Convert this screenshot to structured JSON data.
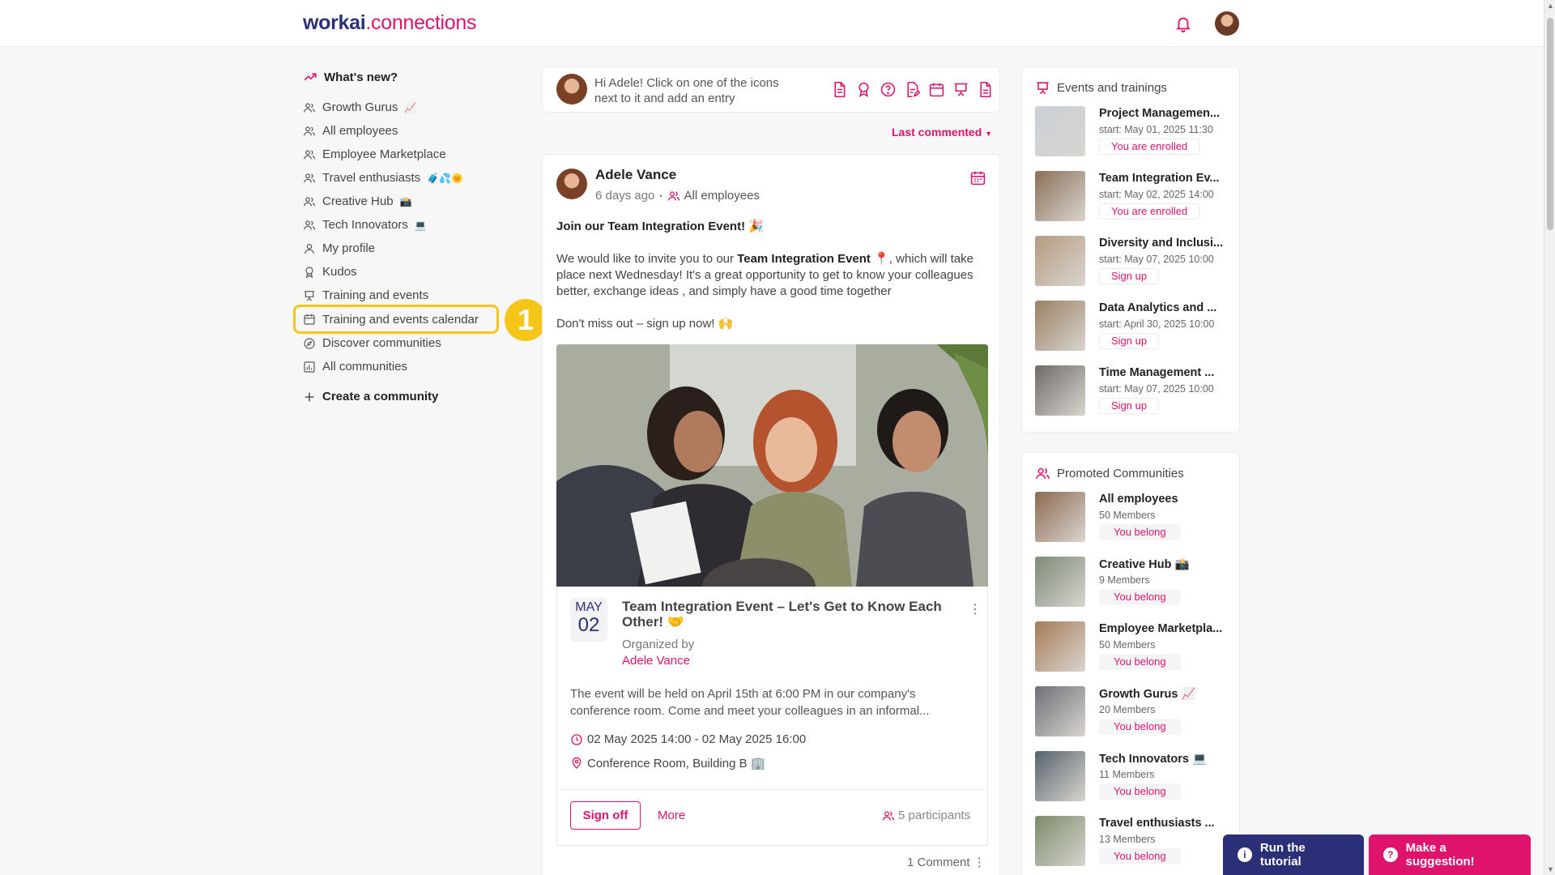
{
  "header": {
    "logo_part1": "workai",
    "logo_part2": ".connections",
    "bell_icon": "bell-icon",
    "avatar_icon": "user-avatar"
  },
  "colors": {
    "accent": "#e0136c",
    "brand_navy": "#2a2f77",
    "highlight": "#f5c518"
  },
  "nav": {
    "title": "What's new?",
    "items": [
      {
        "label": "Growth Gurus",
        "emoji": "📈",
        "icon": "people-icon"
      },
      {
        "label": "All employees",
        "emoji": "",
        "icon": "people-icon"
      },
      {
        "label": "Employee Marketplace",
        "emoji": "",
        "icon": "people-icon"
      },
      {
        "label": "Travel enthusiasts",
        "emoji": "🧳💦🌞",
        "icon": "people-icon"
      },
      {
        "label": "Creative Hub",
        "emoji": "📸",
        "icon": "people-icon"
      },
      {
        "label": "Tech Innovators",
        "emoji": "💻",
        "icon": "people-icon"
      },
      {
        "label": "My profile",
        "emoji": "",
        "icon": "person-icon"
      },
      {
        "label": "Kudos",
        "emoji": "",
        "icon": "award-icon"
      },
      {
        "label": "Training and events",
        "emoji": "",
        "icon": "presentation-icon"
      },
      {
        "label": "Training and events calendar",
        "emoji": "",
        "icon": "calendar-icon"
      },
      {
        "label": "Discover communities",
        "emoji": "",
        "icon": "compass-icon"
      },
      {
        "label": "All communities",
        "emoji": "",
        "icon": "chart-icon"
      }
    ],
    "create_label": "Create a community",
    "marker_number": "1"
  },
  "composer": {
    "prompt": "Hi Adele! Click on one of the icons next to it and add an entry",
    "icons": [
      "document-icon",
      "award-icon",
      "question-icon",
      "edit-document-icon",
      "calendar-icon",
      "presentation-icon",
      "file-icon"
    ]
  },
  "sort_label": "Last commented",
  "post": {
    "author": "Adele Vance",
    "time": "6 days ago",
    "separator": "•",
    "audience": "All employees",
    "headline": "Join our Team Integration Event! 🎉",
    "body_start": "We would like to invite you to our ",
    "body_bold": "Team Integration Event",
    "body_end": " 📍, which will take place next Wednesday! It's a great opportunity to get to know your colleagues better, exchange ideas , and simply have a good time together",
    "cta": "Don't miss out – sign up now! 🙌",
    "event": {
      "month": "MAY",
      "day": "02",
      "title": "Team Integration Event – Let's Get to Know Each Other! 🤝",
      "organized_by": "Organized by",
      "organizer": "Adele Vance",
      "description": "The event will be held on April 15th at 6:00 PM in our company's conference room. Come and meet your colleagues in an informal...",
      "time": "02 May 2025 14:00 - 02 May 2025 16:00",
      "location": "Conference Room, Building B 🏢",
      "signoff_label": "Sign off",
      "more_label": "More",
      "participants": "5 participants"
    },
    "comments": "1 Comment"
  },
  "events_panel": {
    "title": "Events and trainings",
    "items": [
      {
        "name": "Project Managemen...",
        "start": "start: May 01, 2025 11:30",
        "status": "You are enrolled",
        "thumb": "#c9cfd6"
      },
      {
        "name": "Team Integration Ev...",
        "start": "start: May 02, 2025 14:00",
        "status": "You are enrolled",
        "thumb": "#8a6f58"
      },
      {
        "name": "Diversity and Inclusi...",
        "start": "start: May 07, 2025 10:00",
        "status": "Sign up",
        "thumb": "#b59a80"
      },
      {
        "name": "Data Analytics and ...",
        "start": "start: April 30, 2025 10:00",
        "status": "Sign up",
        "thumb": "#9a7f62"
      },
      {
        "name": "Time Management ...",
        "start": "start: May 07, 2025 10:00",
        "status": "Sign up",
        "thumb": "#6f6a66"
      }
    ]
  },
  "communities_panel": {
    "title": "Promoted Communities",
    "items": [
      {
        "name": "All employees",
        "members": "50 Members",
        "status": "You belong",
        "thumb": "#8d6a52"
      },
      {
        "name": "Creative Hub 📸",
        "members": "9 Members",
        "status": "You belong",
        "thumb": "#7d8a78"
      },
      {
        "name": "Employee Marketpla...",
        "members": "50 Members",
        "status": "You belong",
        "thumb": "#a77b58"
      },
      {
        "name": "Growth Gurus 📈",
        "members": "20 Members",
        "status": "You belong",
        "thumb": "#6d7078"
      },
      {
        "name": "Tech Innovators 💻",
        "members": "11 Members",
        "status": "You belong",
        "thumb": "#56636d"
      },
      {
        "name": "Travel enthusiasts ...",
        "members": "13 Members",
        "status": "You belong",
        "thumb": "#7a8a6a"
      }
    ]
  },
  "fabs": {
    "tutorial": "Run the tutorial",
    "suggestion": "Make a suggestion!",
    "info_glyph": "i",
    "question_glyph": "?"
  }
}
